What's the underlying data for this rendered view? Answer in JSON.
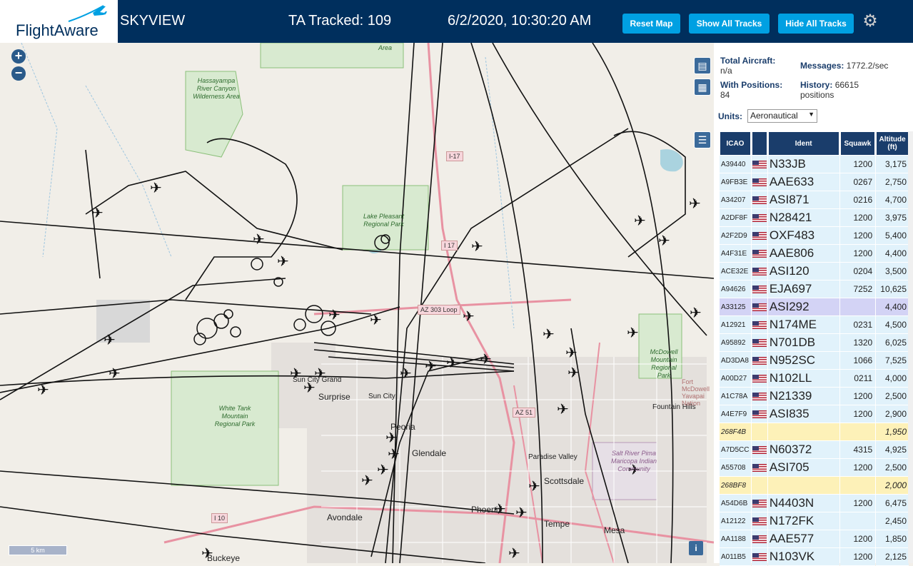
{
  "header": {
    "logo_text": "FlightAware",
    "title": "SKYVIEW",
    "tracked": "TA Tracked: 109",
    "datetime": "6/2/2020, 10:30:20 AM",
    "reset_label": "Reset Map",
    "show_label": "Show All Tracks",
    "hide_label": "Hide All Tracks",
    "settings_icon": "gear-icon"
  },
  "map": {
    "zoom_in": "+",
    "zoom_out": "−",
    "scale_label": "5 km",
    "info_label": "i",
    "labels": {
      "surprise": "Surprise",
      "sun_city": "Sun City",
      "sun_city_grand": "Sun City Grand",
      "peoria": "Peoria",
      "glendale": "Glendale",
      "paradise_valley": "Paradise Valley",
      "scottsdale": "Scottsdale",
      "avondale": "Avondale",
      "phoenix": "Phoenix",
      "tempe": "Tempe",
      "mesa": "Mesa",
      "buckeye": "Buckeye",
      "fountain_hills": "Fountain Hills",
      "fort_mcdowell": "Fort McDowell Yavapai Nation"
    },
    "parks": {
      "hassayampa": "Hassayampa River Canyon Wilderness Area",
      "lake_pleasant": "Lake Pleasant Regional Park",
      "white_tank": "White Tank Mountain Regional Park",
      "mcdowell": "McDowell Mountain Regional Park",
      "salt_river": "Salt River Pima Maricopa Indian Community",
      "area_top": "Area"
    },
    "shields": {
      "i17_north": "I-17",
      "i17_mid": "I 17",
      "az303": "AZ 303 Loop",
      "az51": "AZ 51",
      "i10": "I 10"
    }
  },
  "panel": {
    "total_aircraft_label": "Total Aircraft:",
    "total_aircraft_value": "n/a",
    "messages_label": "Messages:",
    "messages_value": "1772.2/sec",
    "with_positions_label": "With Positions:",
    "with_positions_value": "84",
    "history_label": "History:",
    "history_value": "66615",
    "history_unit": "positions",
    "units_label": "Units:",
    "units_value": "Aeronautical"
  },
  "table": {
    "headers": {
      "icao": "ICAO",
      "ident": "Ident",
      "squawk": "Squawk",
      "altitude": "Altitude (ft)"
    },
    "rows": [
      {
        "icao": "A39440",
        "ident": "N33JB",
        "squawk": "1200",
        "alt": "3,175",
        "flag": true,
        "state": "normal"
      },
      {
        "icao": "A9FB3E",
        "ident": "AAE633",
        "squawk": "0267",
        "alt": "2,750",
        "flag": true,
        "state": "normal"
      },
      {
        "icao": "A34207",
        "ident": "ASI871",
        "squawk": "0216",
        "alt": "4,700",
        "flag": true,
        "state": "normal"
      },
      {
        "icao": "A2DF8F",
        "ident": "N28421",
        "squawk": "1200",
        "alt": "3,975",
        "flag": true,
        "state": "normal"
      },
      {
        "icao": "A2F2D9",
        "ident": "OXF483",
        "squawk": "1200",
        "alt": "5,400",
        "flag": true,
        "state": "normal"
      },
      {
        "icao": "A4F31E",
        "ident": "AAE806",
        "squawk": "1200",
        "alt": "4,400",
        "flag": true,
        "state": "normal"
      },
      {
        "icao": "ACE32E",
        "ident": "ASI120",
        "squawk": "0204",
        "alt": "3,500",
        "flag": true,
        "state": "normal"
      },
      {
        "icao": "A94626",
        "ident": "EJA697",
        "squawk": "7252",
        "alt": "10,625",
        "flag": true,
        "state": "normal"
      },
      {
        "icao": "A33125",
        "ident": "ASI292",
        "squawk": "",
        "alt": "4,400",
        "flag": true,
        "state": "selected"
      },
      {
        "icao": "A12921",
        "ident": "N174ME",
        "squawk": "0231",
        "alt": "4,500",
        "flag": true,
        "state": "normal"
      },
      {
        "icao": "A95892",
        "ident": "N701DB",
        "squawk": "1320",
        "alt": "6,025",
        "flag": true,
        "state": "normal"
      },
      {
        "icao": "AD3DA8",
        "ident": "N952SC",
        "squawk": "1066",
        "alt": "7,525",
        "flag": true,
        "state": "normal"
      },
      {
        "icao": "A00D27",
        "ident": "N102LL",
        "squawk": "0211",
        "alt": "4,000",
        "flag": true,
        "state": "normal"
      },
      {
        "icao": "A1C78A",
        "ident": "N21339",
        "squawk": "1200",
        "alt": "2,500",
        "flag": true,
        "state": "normal"
      },
      {
        "icao": "A4E7F9",
        "ident": "ASI835",
        "squawk": "1200",
        "alt": "2,900",
        "flag": true,
        "state": "normal"
      },
      {
        "icao": "268F4B",
        "ident": "",
        "squawk": "",
        "alt": "1,950",
        "flag": false,
        "state": "nopos"
      },
      {
        "icao": "A7D5CC",
        "ident": "N60372",
        "squawk": "4315",
        "alt": "4,925",
        "flag": true,
        "state": "normal"
      },
      {
        "icao": "A55708",
        "ident": "ASI705",
        "squawk": "1200",
        "alt": "2,500",
        "flag": true,
        "state": "normal"
      },
      {
        "icao": "268BF8",
        "ident": "",
        "squawk": "",
        "alt": "2,000",
        "flag": false,
        "state": "nopos"
      },
      {
        "icao": "A54D6B",
        "ident": "N4403N",
        "squawk": "1200",
        "alt": "6,475",
        "flag": true,
        "state": "normal"
      },
      {
        "icao": "A12122",
        "ident": "N172FK",
        "squawk": "",
        "alt": "2,450",
        "flag": true,
        "state": "normal"
      },
      {
        "icao": "AA1188",
        "ident": "AAE577",
        "squawk": "1200",
        "alt": "1,850",
        "flag": true,
        "state": "normal"
      },
      {
        "icao": "A011B5",
        "ident": "N103VK",
        "squawk": "1200",
        "alt": "2,125",
        "flag": true,
        "state": "normal"
      }
    ]
  }
}
